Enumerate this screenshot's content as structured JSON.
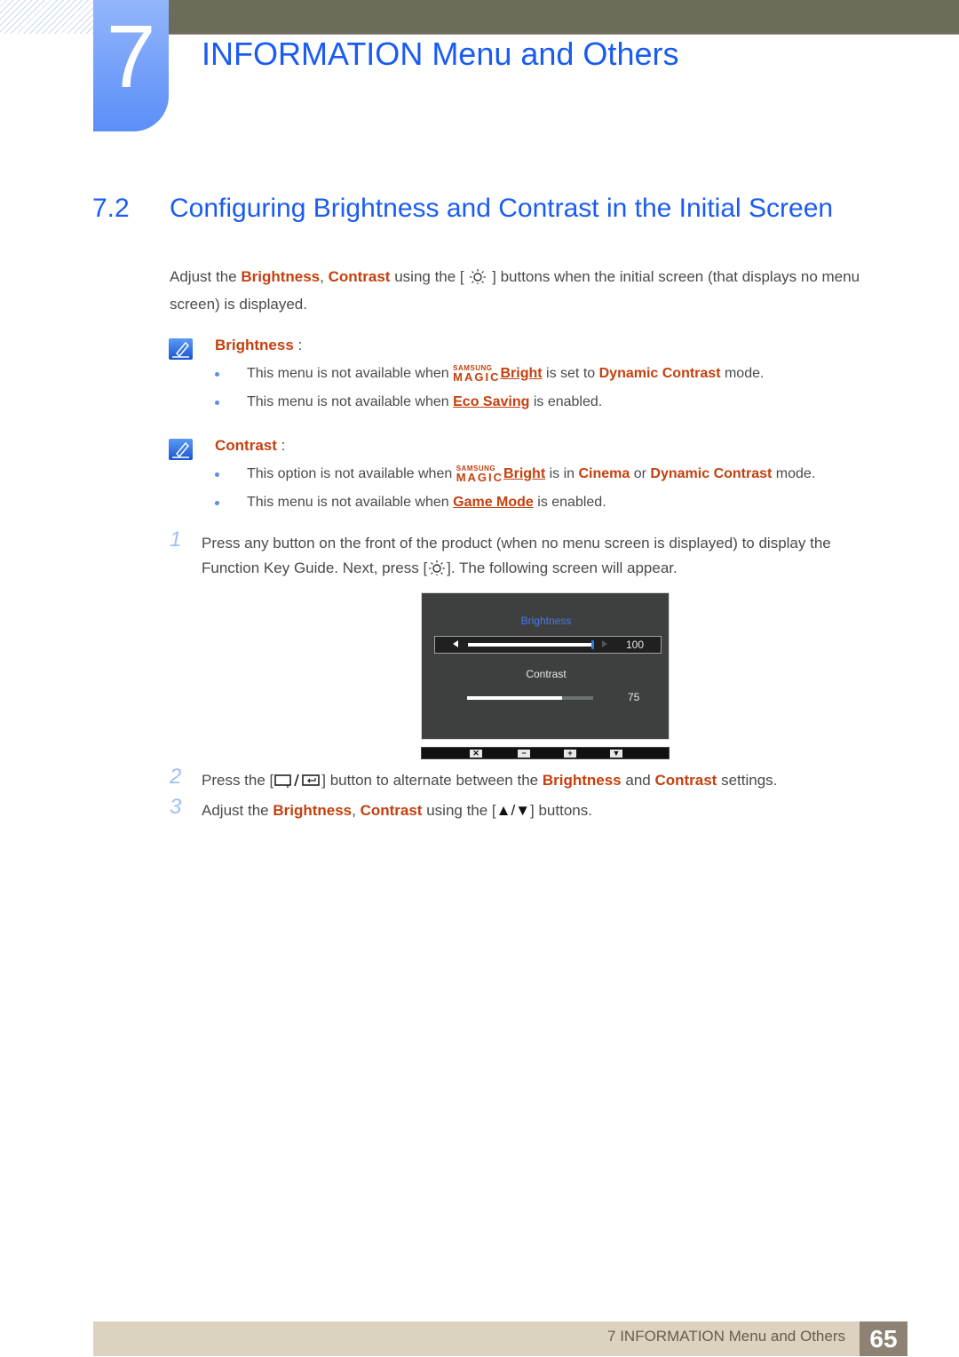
{
  "header": {
    "chapter_number": "7",
    "chapter_title": "INFORMATION Menu and Others",
    "colors": {
      "accent_blue": "#1a5cf2",
      "topbar": "#6d6b59",
      "highlight": "#c4400e"
    }
  },
  "section": {
    "number": "7.2",
    "title": "Configuring Brightness and Contrast in the Initial Screen"
  },
  "intro": {
    "part1": "Adjust the ",
    "brightness": "Brightness",
    "sep": ", ",
    "contrast": "Contrast",
    "part2": " using the [",
    "part3": "] buttons when the initial screen (that displays no menu screen) is displayed."
  },
  "notes": [
    {
      "title": "Brightness",
      "colon": " :",
      "items": [
        {
          "pre": "This menu is not available when ",
          "magic_top": "SAMSUNG",
          "magic_bottom": "MAGIC",
          "link": "Bright",
          "mid": " is set to ",
          "hl1": "Dynamic Contrast",
          "post": " mode."
        },
        {
          "pre": "This menu is not available when ",
          "link": "Eco Saving",
          "post": " is enabled."
        }
      ]
    },
    {
      "title": "Contrast",
      "colon": " :",
      "items": [
        {
          "pre": "This option is not available when ",
          "magic_top": "SAMSUNG",
          "magic_bottom": "MAGIC",
          "link": "Bright",
          "mid": " is in ",
          "hl1": "Cinema",
          "or": " or ",
          "hl2": "Dynamic Contrast",
          "post": " mode."
        },
        {
          "pre": "This menu is not available when ",
          "link": "Game Mode",
          "post": " is enabled."
        }
      ]
    }
  ],
  "steps": [
    {
      "num": "1",
      "line1": "Press any button on the front of the product (when no menu screen is displayed) to display the",
      "line2a": "Function Key Guide. Next, press [",
      "line2b": "]. The following screen will appear."
    },
    {
      "num": "2",
      "pre": "Press the [",
      "mid": "] button to alternate between the ",
      "hl1": "Brightness",
      "and": " and ",
      "hl2": "Contrast",
      "post": " settings."
    },
    {
      "num": "3",
      "pre": "Adjust the ",
      "hl1": "Brightness",
      "sep": ", ",
      "hl2": "Contrast",
      "mid": " using the [",
      "arrows": "▲/▼",
      "post": "] buttons."
    }
  ],
  "osd": {
    "brightness_label": "Brightness",
    "brightness_value": "100",
    "brightness_fraction": 1.0,
    "contrast_label": "Contrast",
    "contrast_value": "75",
    "contrast_fraction": 0.75,
    "keys": [
      "✕",
      "−",
      "+",
      "▼"
    ],
    "key_icons": [
      "close-icon",
      "minus-icon",
      "plus-icon",
      "down-arrow-icon"
    ]
  },
  "footer": {
    "chapter_label": "7 INFORMATION Menu and Others",
    "page_number": "65"
  }
}
